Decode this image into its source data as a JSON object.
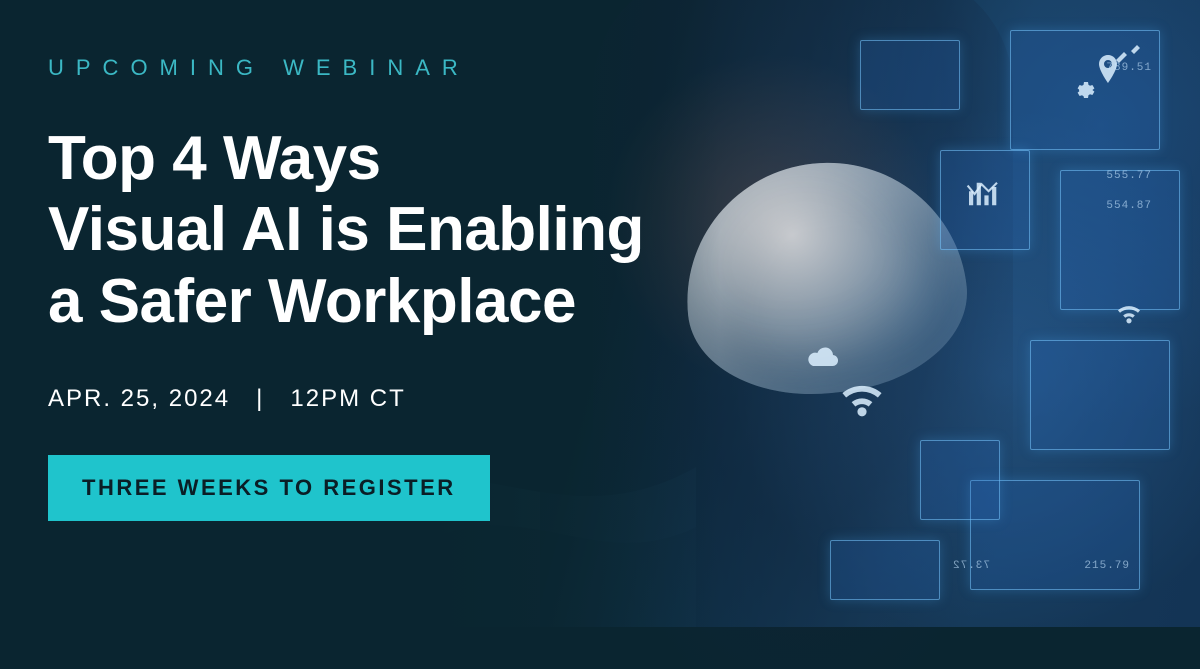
{
  "eyebrow": "UPCOMING WEBINAR",
  "headline_line1": "Top 4 Ways",
  "headline_line2": "Visual AI is Enabling",
  "headline_line3": "a Safer Workplace",
  "date": "APR. 25, 2024",
  "separator": "|",
  "time": "12PM CT",
  "cta_label": "THREE WEEKS TO REGISTER",
  "panel_numbers": {
    "n1": "789.51",
    "n2": "554.87",
    "n3": "215.79",
    "n4": "73.72",
    "n5": "555.77"
  },
  "colors": {
    "accent": "#1fc4cc",
    "eyebrow": "#3bb8c4",
    "background": "#0a2530",
    "text": "#ffffff"
  }
}
